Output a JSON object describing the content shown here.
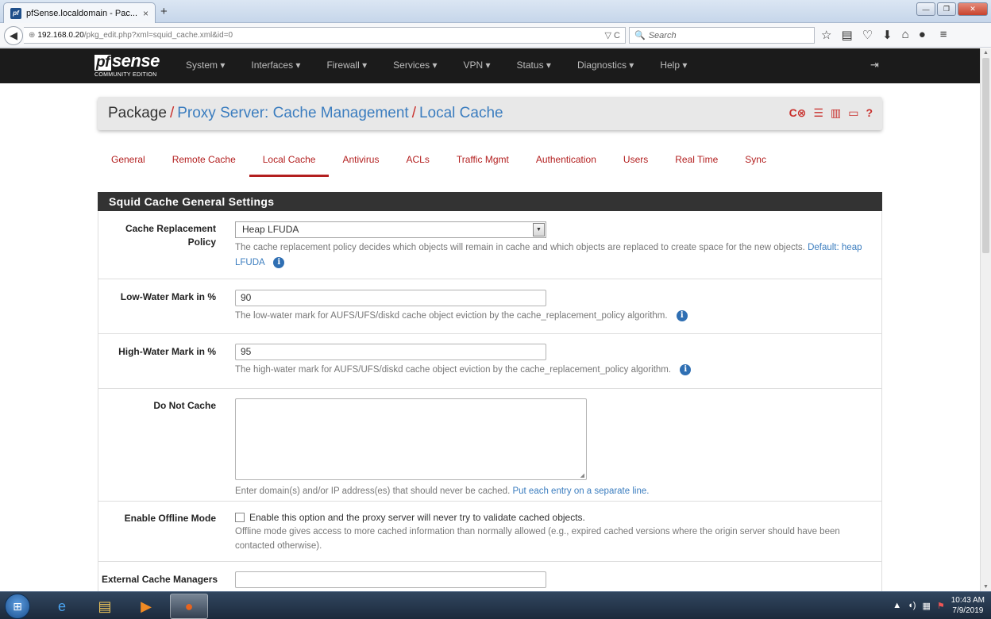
{
  "browser": {
    "tab_title": "pfSense.localdomain - Pac...",
    "tab_close": "×",
    "new_tab": "+",
    "url_host": "192.168.0.20",
    "url_path": "/pkg_edit.php?xml=squid_cache.xml&id=0",
    "url_reload": "▽ C",
    "search_placeholder": "Search",
    "window_min": "—",
    "window_max": "❐",
    "window_close": "✕"
  },
  "pfsense": {
    "logo_pf": "pf",
    "logo_text": "sense",
    "logo_sub": "COMMUNITY EDITION",
    "menu": [
      "System ▾",
      "Interfaces ▾",
      "Firewall ▾",
      "Services ▾",
      "VPN ▾",
      "Status ▾",
      "Diagnostics ▾",
      "Help ▾"
    ]
  },
  "breadcrumb": {
    "root": "Package",
    "sep1": "/",
    "section": "Proxy Server: Cache Management",
    "sep2": "/",
    "page": "Local Cache"
  },
  "subtabs": [
    "General",
    "Remote Cache",
    "Local Cache",
    "Antivirus",
    "ACLs",
    "Traffic Mgmt",
    "Authentication",
    "Users",
    "Real Time",
    "Sync"
  ],
  "active_subtab": "Local Cache",
  "panel": {
    "title": "Squid Cache General Settings",
    "cache_policy": {
      "label": "Cache Replacement Policy",
      "value": "Heap LFUDA",
      "help": "The cache replacement policy decides which objects will remain in cache and which objects are replaced to create space for the new objects.",
      "default_prefix": "Default:",
      "default_value": "heap LFUDA"
    },
    "low_water": {
      "label": "Low-Water Mark in %",
      "value": "90",
      "help": "The low-water mark for AUFS/UFS/diskd cache object eviction by the cache_replacement_policy algorithm."
    },
    "high_water": {
      "label": "High-Water Mark in %",
      "value": "95",
      "help": "The high-water mark for AUFS/UFS/diskd cache object eviction by the cache_replacement_policy algorithm."
    },
    "do_not_cache": {
      "label": "Do Not Cache",
      "value": "",
      "help": "Enter domain(s) and/or IP address(es) that should never be cached.",
      "help_link": "Put each entry on a separate line."
    },
    "offline_mode": {
      "label": "Enable Offline Mode",
      "checkbox_label": "Enable this option and the proxy server will never try to validate cached objects.",
      "checked": false,
      "help": "Offline mode gives access to more cached information than normally allowed (e.g., expired cached versions where the origin server should have been contacted otherwise)."
    },
    "external_managers": {
      "label": "External Cache Managers",
      "value": ""
    }
  },
  "taskbar": {
    "time": "10:43 AM",
    "date": "7/9/2019"
  }
}
